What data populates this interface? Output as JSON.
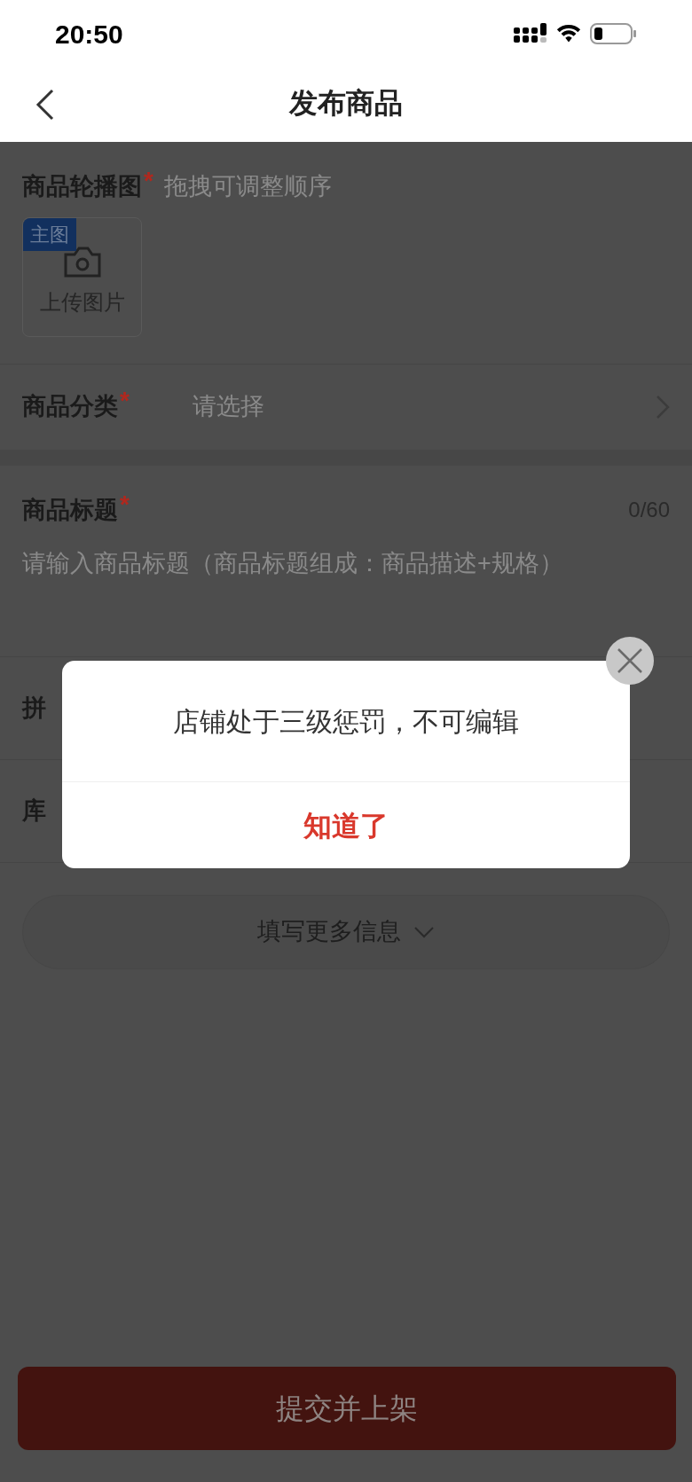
{
  "status_bar": {
    "time": "20:50"
  },
  "nav": {
    "title": "发布商品"
  },
  "carousel": {
    "label": "商品轮播图",
    "mark": "*",
    "hint": "拖拽可调整顺序",
    "upload": {
      "badge": "主图",
      "label": "上传图片"
    }
  },
  "category": {
    "label": "商品分类",
    "mark": "*",
    "placeholder": "请选择"
  },
  "title_field": {
    "label": "商品标题",
    "mark": "*",
    "counter": "0/60",
    "placeholder": "请输入商品标题（商品标题组成：商品描述+规格）"
  },
  "rows": [
    {
      "label": "拼"
    },
    {
      "label": "库"
    }
  ],
  "more_button": {
    "label": "填写更多信息"
  },
  "submit_button": {
    "label": "提交并上架",
    "disabled": true
  },
  "dialog": {
    "message": "店铺处于三级惩罚，不可编辑",
    "button": "知道了"
  }
}
